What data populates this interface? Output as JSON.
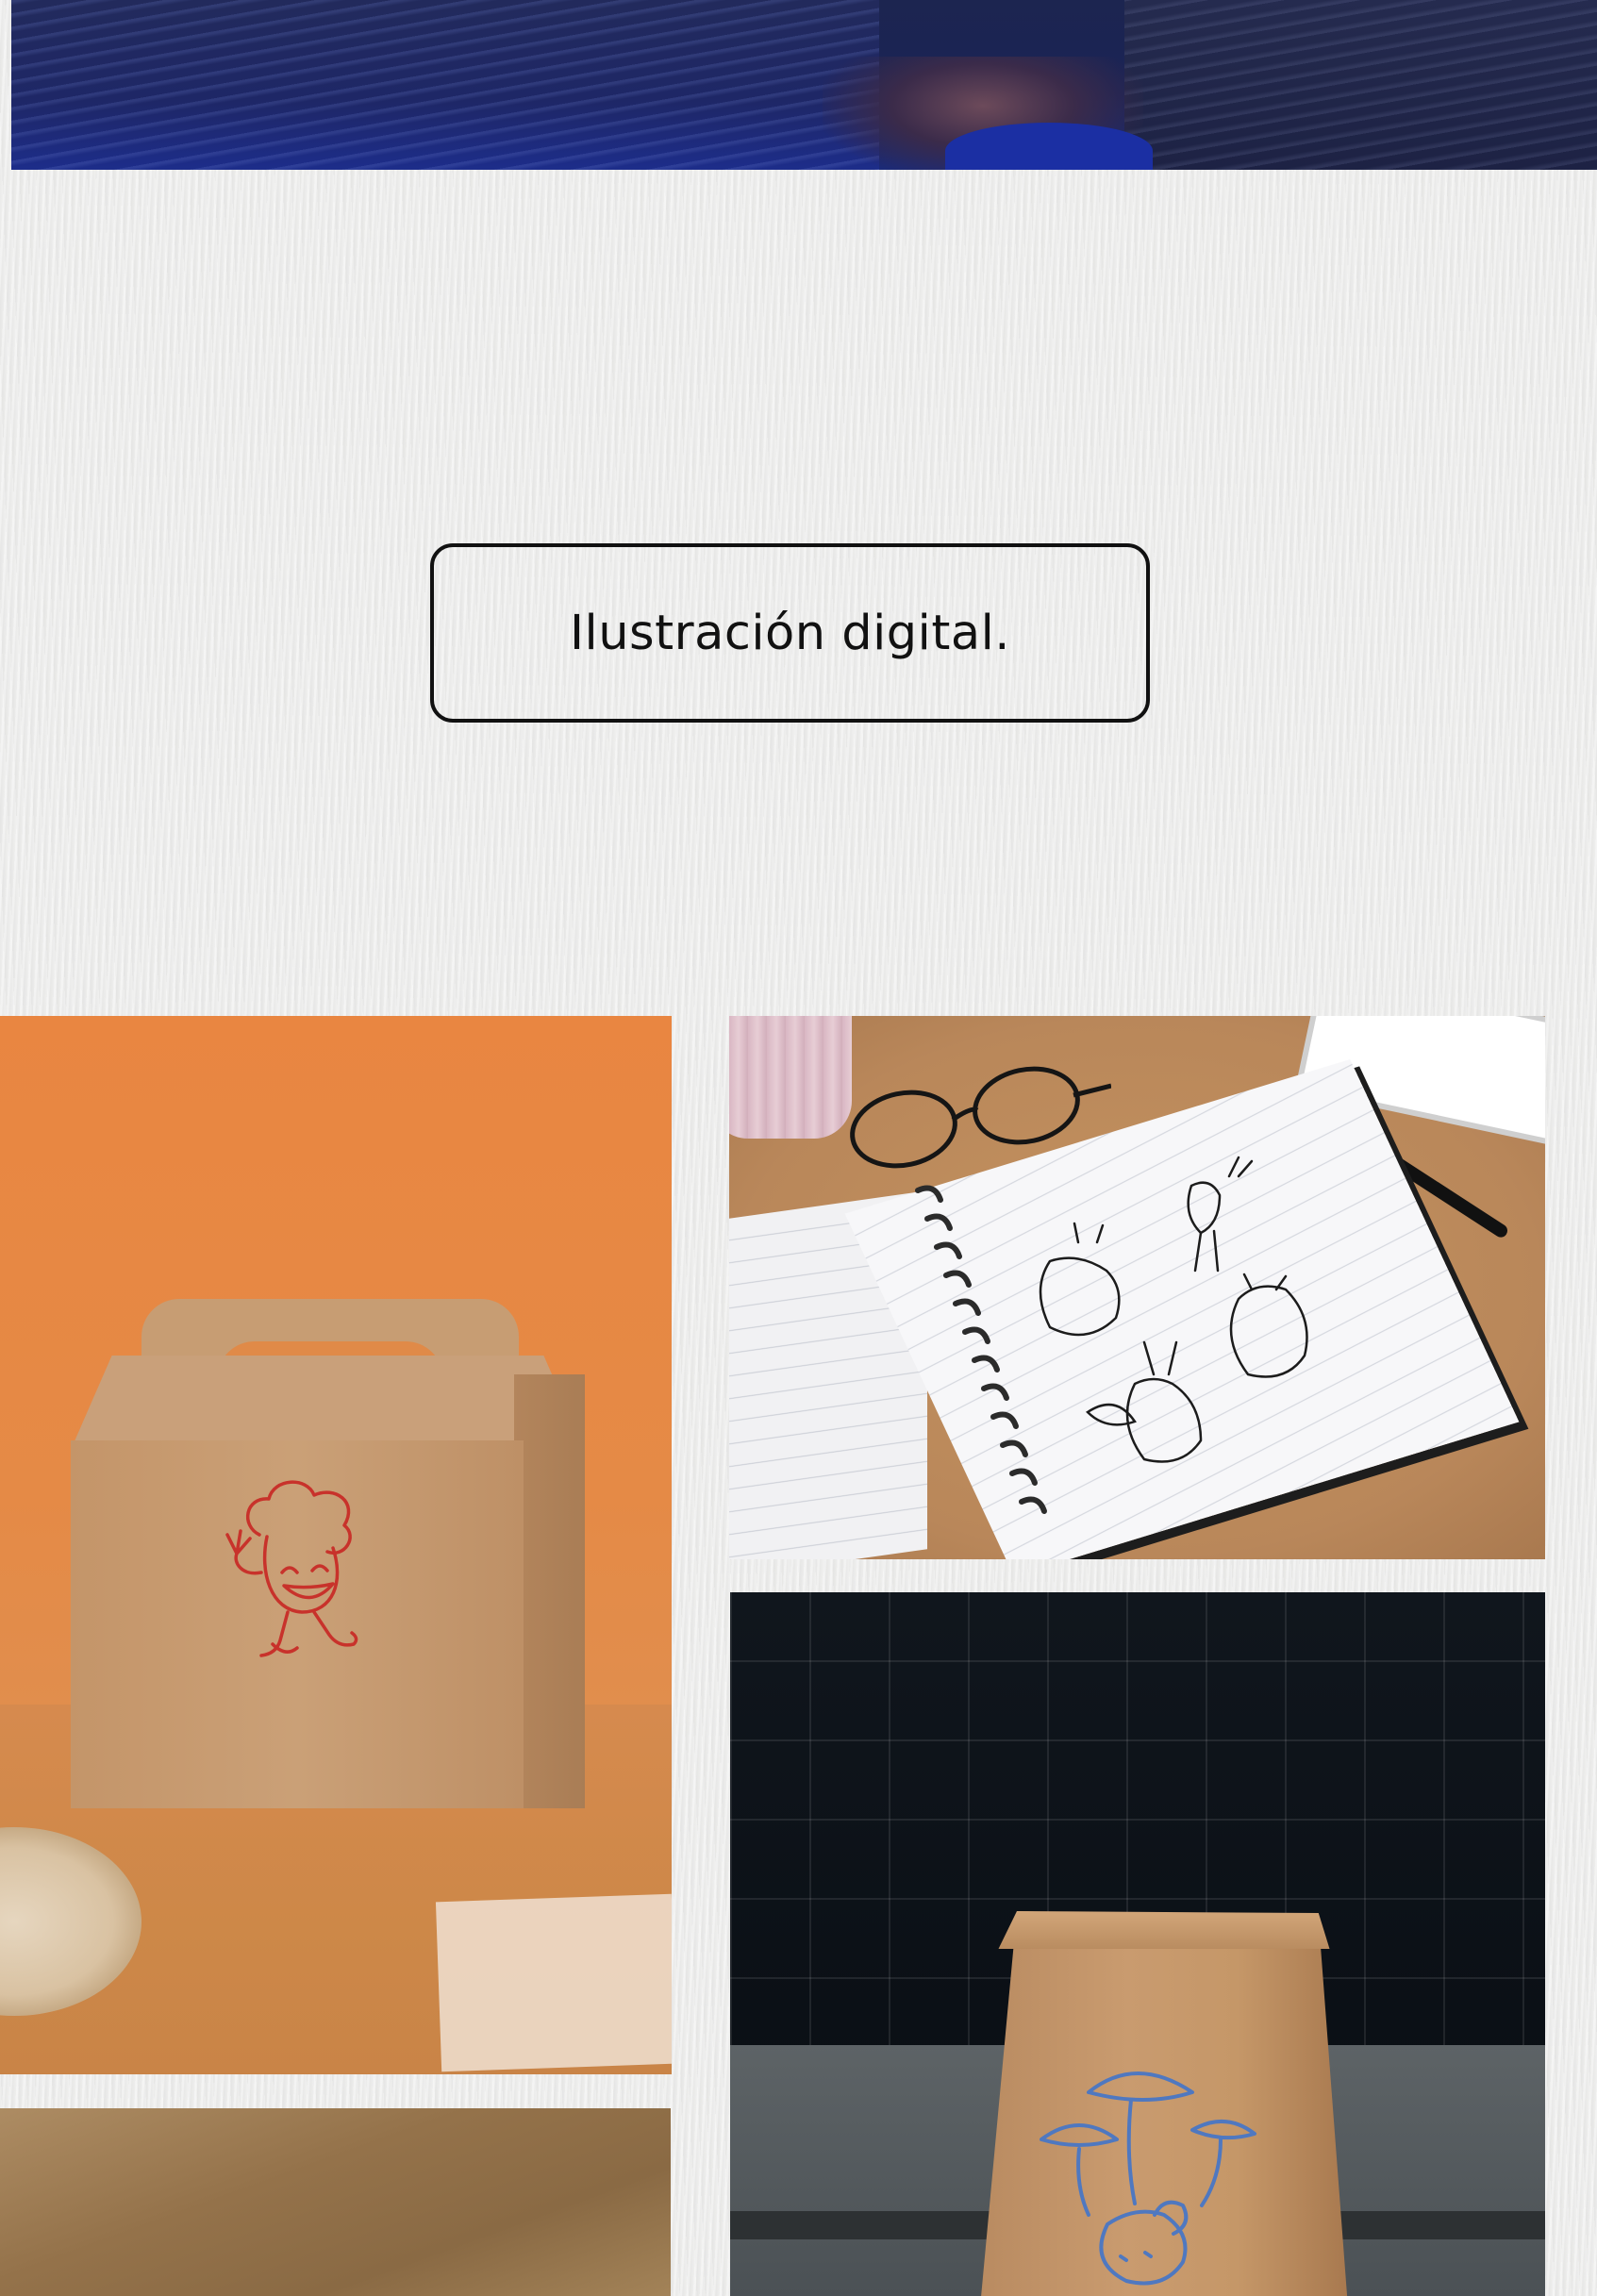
{
  "section": {
    "category_label": "Ilustración digital."
  },
  "gallery": {
    "items": [
      {
        "icon": "kraft-box-mascot-mockup"
      },
      {
        "icon": "notebook-animal-sketches-mockup"
      },
      {
        "icon": "paper-bag-mushroom-mockup"
      },
      {
        "icon": "partial-tan-mockup"
      }
    ]
  },
  "colors": {
    "background": "#ececeb",
    "pill_border": "#111111",
    "box_backdrop": "#e98641",
    "mascot_line": "#c8322b",
    "bag_line": "#4f78c0"
  }
}
